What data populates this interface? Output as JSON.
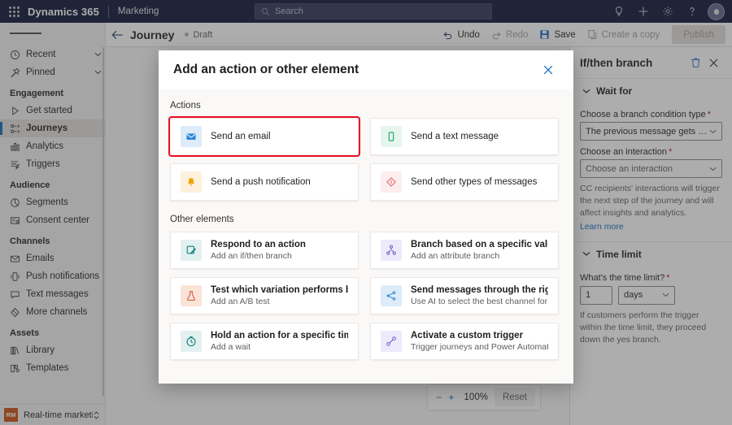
{
  "suitebar": {
    "waffle_label": "app-launcher",
    "brand": "Dynamics 365",
    "app_name": "Marketing",
    "search_placeholder": "Search",
    "icons": [
      "lightbulb-icon",
      "plus-icon",
      "gear-icon",
      "question-icon",
      "avatar"
    ]
  },
  "sidebar": {
    "menu_label": "site-map-toggle",
    "collapsibles": [
      {
        "label": "Recent",
        "icon": "clock-icon"
      },
      {
        "label": "Pinned",
        "icon": "pin-icon"
      }
    ],
    "groups": [
      {
        "title": "Engagement",
        "items": [
          {
            "label": "Get started",
            "icon": "play-icon",
            "selected": false
          },
          {
            "label": "Journeys",
            "icon": "journeys-icon",
            "selected": true
          },
          {
            "label": "Analytics",
            "icon": "analytics-icon",
            "selected": false
          },
          {
            "label": "Triggers",
            "icon": "triggers-icon",
            "selected": false
          }
        ]
      },
      {
        "title": "Audience",
        "items": [
          {
            "label": "Segments",
            "icon": "segments-icon",
            "selected": false
          },
          {
            "label": "Consent center",
            "icon": "consent-icon",
            "selected": false
          }
        ]
      },
      {
        "title": "Channels",
        "items": [
          {
            "label": "Emails",
            "icon": "mail-icon",
            "selected": false
          },
          {
            "label": "Push notifications",
            "icon": "push-icon",
            "selected": false
          },
          {
            "label": "Text messages",
            "icon": "chat-icon",
            "selected": false
          },
          {
            "label": "More channels",
            "icon": "more-channels-icon",
            "selected": false
          }
        ]
      },
      {
        "title": "Assets",
        "items": [
          {
            "label": "Library",
            "icon": "library-icon",
            "selected": false
          },
          {
            "label": "Templates",
            "icon": "templates-icon",
            "selected": false
          }
        ]
      }
    ],
    "area_switcher": {
      "badge": "RM",
      "label": "Real-time marketi...",
      "icon": "updown-chevron-icon"
    }
  },
  "commandbar": {
    "back_icon": "back-arrow-icon",
    "title": "Journey",
    "status": "Draft",
    "buttons": [
      {
        "label": "Undo",
        "icon": "undo-icon",
        "disabled": false
      },
      {
        "label": "Redo",
        "icon": "redo-icon",
        "disabled": true
      },
      {
        "label": "Save",
        "icon": "save-icon",
        "disabled": false
      },
      {
        "label": "Create a copy",
        "icon": "copy-icon",
        "disabled": true
      }
    ],
    "publish_label": "Publish"
  },
  "canvas": {
    "zoom": {
      "minus": "−",
      "plus": "+",
      "value": "100%",
      "reset_label": "Reset"
    }
  },
  "rightpanel": {
    "title": "If/then branch",
    "delete_icon": "trash-icon",
    "close_icon": "close-icon",
    "sections": [
      {
        "label": "Wait for"
      },
      {
        "label": "Time limit"
      }
    ],
    "branch_condition": {
      "label": "Choose a branch condition type",
      "required": "*",
      "value": "The previous message gets an interacti..."
    },
    "interaction": {
      "label": "Choose an interaction",
      "required": "*",
      "placeholder": "Choose an interaction"
    },
    "interaction_help": "CC recipients' interactions will trigger the next step of the journey and will affect insights and analytics.",
    "learn_more": "Learn more",
    "time_limit": {
      "label": "What's the time limit?",
      "required": "*",
      "value": "1",
      "unit": "days",
      "help": "If customers perform the trigger within the time limit, they proceed down the yes branch."
    }
  },
  "dialog": {
    "title": "Add an action or other element",
    "close_icon": "close-icon",
    "sections": [
      {
        "title": "Actions",
        "cards": [
          {
            "title": "Send an email",
            "subtitle": "",
            "icon": "mail-icon",
            "tile": "#deecf9",
            "fg": "#0f6cbd",
            "highlighted": true
          },
          {
            "title": "Send a text message",
            "subtitle": "",
            "icon": "phone-icon",
            "tile": "#e6f6ef",
            "fg": "#107c41",
            "highlighted": false
          },
          {
            "title": "Send a push notification",
            "subtitle": "",
            "icon": "bell-icon",
            "tile": "#fdf1dd",
            "fg": "#e08b17",
            "highlighted": false
          },
          {
            "title": "Send other types of messages",
            "subtitle": "",
            "icon": "diamond-icon",
            "tile": "#fdeeee",
            "fg": "#d13438",
            "highlighted": false
          }
        ]
      },
      {
        "title": "Other elements",
        "cards": [
          {
            "title": "Respond to an action",
            "subtitle": "Add an if/then branch",
            "icon": "respond-icon",
            "tile": "#e2f1f0",
            "fg": "#0f7b78",
            "highlighted": false
          },
          {
            "title": "Branch based on a specific value",
            "subtitle": "Add an attribute branch",
            "icon": "branch-icon",
            "tile": "#edeafc",
            "fg": "#6b5ecb",
            "highlighted": false
          },
          {
            "title": "Test which variation performs better",
            "subtitle": "Add an A/B test",
            "icon": "flask-icon",
            "tile": "#fbe3d8",
            "fg": "#d4623a",
            "highlighted": false
          },
          {
            "title": "Send messages through the right channel",
            "subtitle": "Use AI to select the best channel for each person",
            "icon": "channel-ai-icon",
            "tile": "#deecf9",
            "fg": "#0f6cbd",
            "highlighted": false
          },
          {
            "title": "Hold an action for a specific time",
            "subtitle": "Add a wait",
            "icon": "timer-icon",
            "tile": "#e2f1f0",
            "fg": "#0f7b78",
            "highlighted": false
          },
          {
            "title": "Activate a custom trigger",
            "subtitle": "Trigger journeys and Power Automate flows",
            "icon": "custom-trigger-icon",
            "tile": "#edeafc",
            "fg": "#6b5ecb",
            "highlighted": false
          }
        ]
      }
    ]
  }
}
